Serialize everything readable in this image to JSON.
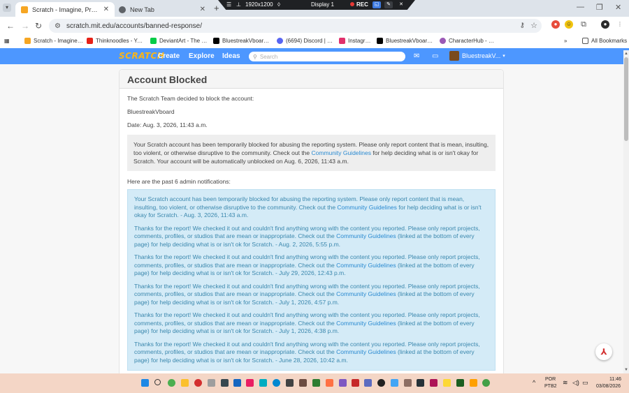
{
  "browser": {
    "tabs": [
      {
        "title": "Scratch - Imagine, Program, Sha",
        "active": true
      },
      {
        "title": "New Tab",
        "active": false
      }
    ],
    "recording": {
      "resolution": "1920x1200",
      "display": "Display 1",
      "rec": "REC"
    },
    "url": "scratch.mit.edu/accounts/banned-response/",
    "bookmarks": [
      {
        "label": "Scratch - Imagine, P..."
      },
      {
        "label": "Thinknoodles - You..."
      },
      {
        "label": "DeviantArt - The Lar..."
      },
      {
        "label": "BluestreakVboard (..."
      },
      {
        "label": "(6694) Discord | Frie..."
      },
      {
        "label": "Instagram"
      },
      {
        "label": "BluestreakVboard (..."
      },
      {
        "label": "CharacterHub - Sha..."
      }
    ],
    "all_bookmarks": "All Bookmarks"
  },
  "scratch_nav": {
    "logo": "SCRATCH",
    "create": "Create",
    "explore": "Explore",
    "ideas": "Ideas",
    "search_placeholder": "Search",
    "username": "BluestreakV..."
  },
  "page": {
    "title": "Account Blocked",
    "intro": "The Scratch Team decided to block the account:",
    "account": "BluestreakVboard",
    "date": "Date: Aug. 3, 2026, 11:43 a.m.",
    "message_before": "Your Scratch account has been temporarily blocked for abusing the reporting system. Please only report content that is mean, insulting, too violent, or otherwise disruptive to the community. Check out the ",
    "message_link": "Community Guidelines",
    "message_after": " for help deciding what is or isn't okay for Scratch. Your account will be automatically unblocked on Aug. 6, 2026, 11:43 a.m.",
    "notifications_heading": "Here are the past 6 admin notifications:",
    "notifications": [
      {
        "before": "Your Scratch account has been temporarily blocked for abusing the reporting system. Please only report content that is mean, insulting, too violent, or otherwise disruptive to the community. Check out the ",
        "link": "Community Guidelines",
        "after": " for help deciding what is or isn't okay for Scratch. - Aug. 3, 2026, 11:43 a.m."
      },
      {
        "before": "Thanks for the report! We checked it out and couldn't find anything wrong with the content you reported. Please only report projects, comments, profiles, or studios that are mean or inappropriate. Check out the ",
        "link": "Community Guidelines",
        "after": " (linked at the bottom of every page) for help deciding what is or isn't ok for Scratch. - Aug. 2, 2026, 5:55 p.m."
      },
      {
        "before": "Thanks for the report! We checked it out and couldn't find anything wrong with the content you reported. Please only report projects, comments, profiles, or studios that are mean or inappropriate. Check out the ",
        "link": "Community Guidelines",
        "after": " (linked at the bottom of every page) for help deciding what is or isn't ok for Scratch. - July 29, 2026, 12:43 p.m."
      },
      {
        "before": "Thanks for the report! We checked it out and couldn't find anything wrong with the content you reported. Please only report projects, comments, profiles, or studios that are mean or inappropriate. Check out the ",
        "link": "Community Guidelines",
        "after": " (linked at the bottom of every page) for help deciding what is or isn't ok for Scratch. - July 1, 2026, 4:57 p.m."
      },
      {
        "before": "Thanks for the report! We checked it out and couldn't find anything wrong with the content you reported. Please only report projects, comments, profiles, or studios that are mean or inappropriate. Check out the ",
        "link": "Community Guidelines",
        "after": " (linked at the bottom of every page) for help deciding what is or isn't ok for Scratch. - July 1, 2026, 4:38 p.m."
      },
      {
        "before": "Thanks for the report! We checked it out and couldn't find anything wrong with the content you reported. Please only report projects, comments, profiles, or studios that are mean or inappropriate. Check out the ",
        "link": "Community Guidelines",
        "after": " (linked at the bottom of every page) for help deciding what is or isn't ok for Scratch. - June 28, 2026, 10:42 a.m."
      }
    ]
  },
  "taskbar": {
    "lang1": "POR",
    "lang2": "PTB2",
    "time": "11:46",
    "date": "03/08/2026"
  }
}
